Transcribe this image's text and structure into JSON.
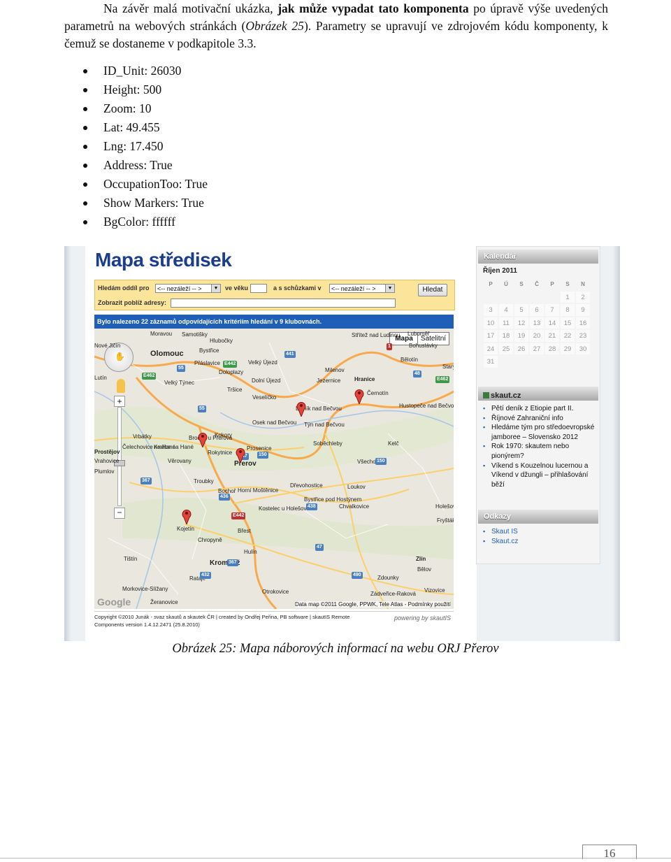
{
  "intro": {
    "p1": "Na závěr malá motivační ukázka, ",
    "bold": "jak může vypadat tato komponenta",
    "p2": " po úpravě výše uvedených parametrů na webových stránkách (",
    "ref": "Obrázek 25",
    "p3": "). Parametry se upravují ve zdrojovém kódu komponenty, k čemuž se dostaneme v podkapitole 3.3."
  },
  "bullets": [
    "ID_Unit: 26030",
    "Height: 500",
    "Zoom: 10",
    "Lat: 49.455",
    "Lng: 17.450",
    "Address: True",
    "OccupationToo: True",
    "Show Markers: True",
    "BgColor: ffffff"
  ],
  "screenshot": {
    "site_title": "Mapa středisek",
    "search": {
      "label_hledam": "Hledám oddíl pro",
      "select1": "<-- nezáleží -- >",
      "label_ve_veku": "ve věku",
      "label_schuzky": "a s schůzkami v",
      "select2": "<-- nezáleží -- >",
      "button": "Hledat",
      "label_address": "Zobrazit poblíž adresy:"
    },
    "result_text": "Bylo nalezeno 22 záznamů odpovídajících kritériím hledání v 9 klubovnách.",
    "map": {
      "type_map": "Mapa",
      "type_sat": "Satelitní",
      "towns": [
        "Moravou",
        "Samotišky",
        "Hlubočky",
        "Střítež nad Ludinou",
        "Luboměř",
        "Bohuslávky",
        "Nové Jičín",
        "Olomouc",
        "Přáslavice",
        "Bystřice",
        "Doloplazy",
        "Velký Újezd",
        "Dolní Újezd",
        "Jezernice",
        "Milenov",
        "Hranice",
        "Bělotín",
        "Černotín",
        "Starý",
        "Lutín",
        "Velký Týnec",
        "Tršice",
        "Veselíčko",
        "Lipník nad Bečvou",
        "Týn nad Bečvou",
        "Hustopeče nad Bečvou",
        "Kokory",
        "Brodek u Přerova",
        "Osek nad Bečvou",
        "Soběchleby",
        "Kelč",
        "Vrbátky",
        "Prostějov",
        "Plumlov",
        "Čelechovice na Hané",
        "Kralice na Hané",
        "Vrahovice",
        "Věrovany",
        "Rokytnice",
        "Přerov",
        "Prosenice",
        "Všechovice",
        "Troubky",
        "Bochoř",
        "Horní Moštěnice",
        "Dřevohostice",
        "Loukov",
        "Bystřice pod Hostýnem",
        "Holešov",
        "Chvalkovice",
        "Kojetín",
        "Chropyně",
        "Kostelec u Holešova",
        "Fryšták",
        "Břest",
        "Hulín",
        "Tištín",
        "Kroměříž",
        "Rataje",
        "Zdounky",
        "Zlín",
        "Morkovice-Slížany",
        "Otrokovice",
        "Zádveřice-Raková",
        "Vizovice",
        "Žeranovice",
        "Bělov"
      ],
      "roads": [
        "441",
        "E462",
        "55",
        "E442",
        "48",
        "E462",
        "55",
        "47",
        "150",
        "367",
        "436",
        "438",
        "150",
        "47",
        "367",
        "432",
        "490",
        "1",
        "E442"
      ],
      "copyright": "Data map ©2011 Google, PPWK, Tele Atlas - Podmínky použití",
      "google": "Google"
    },
    "footer": {
      "line1": "Copyright ©2010 Junák - svaz skautů a skautek ČR | created by Ondřej Peřina, PB software | skautIS Remote",
      "line2": "Components version 1.4.12.2471 (25.8.2010)",
      "powered": "powering by skautIS"
    },
    "sidebar": {
      "calendar_title": "Kalendář",
      "month": "Říjen 2011",
      "day_headers": [
        "P",
        "Ú",
        "S",
        "Č",
        "P",
        "S",
        "N"
      ],
      "days": [
        "",
        "",
        "",
        "",
        "",
        "1",
        "2",
        "3",
        "4",
        "5",
        "6",
        "7",
        "8",
        "9",
        "10",
        "11",
        "12",
        "13",
        "14",
        "15",
        "16",
        "17",
        "18",
        "19",
        "20",
        "21",
        "22",
        "23",
        "24",
        "25",
        "26",
        "27",
        "28",
        "29",
        "30",
        "31",
        "",
        "",
        "",
        "",
        "",
        ""
      ],
      "skaut_title": "skaut.cz",
      "skaut_links": [
        "Pětí deník z Etiopie part II.",
        "Říjnové Zahraniční info",
        "Hledáme tým pro středoevropské jamboree – Slovensko 2012",
        "Rok 1970: skautem nebo pionýrem?",
        "Víkend s Kouzelnou lucernou a Víkend v džungli – přihlašování běží"
      ],
      "odkazy_title": "Odkazy",
      "odkazy_links": [
        "Skaut IS",
        "Skaut.cz"
      ]
    }
  },
  "caption": {
    "label": "Obrázek 25:",
    "text": " Mapa náborových informací na webu ORJ Přerov"
  },
  "page_number": "16"
}
